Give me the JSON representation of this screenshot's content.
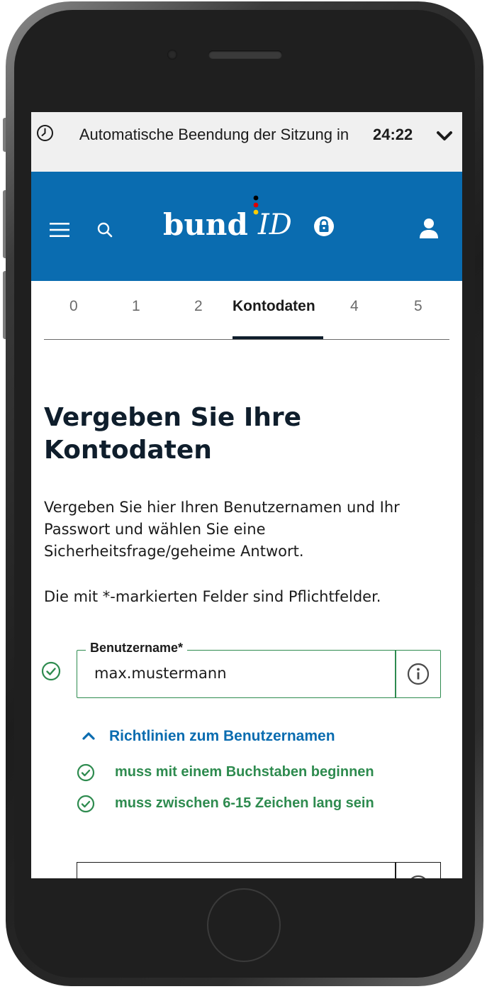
{
  "session": {
    "message": "Automatische Beendung der Sitzung in",
    "time": "24:22",
    "clock_icon": "clock-icon",
    "expand_icon": "chevron-down-icon"
  },
  "header": {
    "brand_primary": "bund",
    "brand_secondary": "ID",
    "menu_icon": "hamburger-menu-icon",
    "search_icon": "search-icon",
    "lock_icon": "lock-icon",
    "user_icon": "user-icon",
    "color": "#0a6cb0"
  },
  "steps": {
    "items": [
      {
        "label": "0"
      },
      {
        "label": "1"
      },
      {
        "label": "2"
      },
      {
        "label": "Kontodaten",
        "active": true
      },
      {
        "label": "4"
      },
      {
        "label": "5"
      }
    ]
  },
  "main": {
    "title": "Vergeben Sie Ihre Kontodaten",
    "intro": "Vergeben Sie hier Ihren Benutzernamen und Ihr Passwort und wählen Sie eine Sicherheitsfrage/geheime Antwort.",
    "required_note": "Die mit *-markierten Felder sind Pflichtfelder."
  },
  "username_field": {
    "label": "Benutzername*",
    "value": "max.mustermann",
    "status": "valid",
    "info_icon": "info-icon",
    "valid_color": "#2e8b4f"
  },
  "rules": {
    "toggle_label": "Richtlinien zum Benutzernamen",
    "toggle_icon": "chevron-up-icon",
    "items": [
      {
        "text": "muss mit einem Buchstaben beginnen",
        "status": "fulfilled"
      },
      {
        "text": "muss zwischen 6-15 Zeichen lang sein",
        "status": "fulfilled"
      }
    ]
  }
}
